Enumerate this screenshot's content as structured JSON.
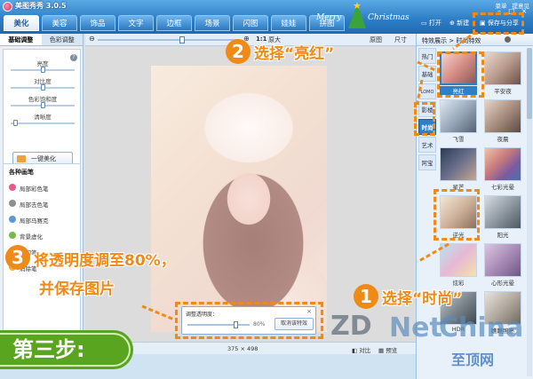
{
  "app": {
    "title": "美图秀秀 3.0.5"
  },
  "top_tabs": [
    "美化",
    "美容",
    "饰品",
    "文字",
    "边框",
    "场景",
    "闪图",
    "娃娃",
    "拼图"
  ],
  "top_links": {
    "menu": "菜单",
    "feedback": "提意见"
  },
  "banner": {
    "merry": "Merry",
    "christmas": "Christmas"
  },
  "toolbar": {
    "open": "打开",
    "new": "新建",
    "save_share": "保存与分享"
  },
  "left_panel": {
    "tabs": [
      "基础调整",
      "色彩调整"
    ],
    "sliders": [
      {
        "label": "亮度",
        "value": 0.5
      },
      {
        "label": "对比度",
        "value": 0.5
      },
      {
        "label": "色彩饱和度",
        "value": 0.5
      },
      {
        "label": "清晰度",
        "value": 0.05
      }
    ],
    "one_click_label": "一键美化",
    "brushes_title": "各种画笔",
    "brushes": [
      "局部彩色笔",
      "局部去色笔",
      "局部马赛克",
      "背景虚化",
      "魔幻笔",
      "消除笔"
    ]
  },
  "zoombar": {
    "ratio_label": "1:1",
    "original_label": "原大",
    "original_size_label": "原图",
    "size_label": "尺寸",
    "zoom_value": 0.6
  },
  "status": {
    "dimensions": "375 × 498",
    "compare": "对比",
    "preview": "预览"
  },
  "opacity_dialog": {
    "title": "调整透明度：",
    "value_text": "80%",
    "value": 0.8,
    "cancel": "取消该特效"
  },
  "right_panel": {
    "header": "特效展示 > 时尚特效",
    "categories": [
      "热门",
      "基础",
      "LOMO",
      "影楼",
      "时尚",
      "艺术",
      "阿宝"
    ],
    "selected_category": "时尚",
    "effects": [
      "亮红",
      "平安夜",
      "飞雪",
      "夜晨",
      "星芒",
      "七彩光晕",
      "逆光",
      "阳光",
      "炫彩",
      "心形光晕",
      "HDR",
      "瞧瞧照亮"
    ],
    "selected_effect": "亮红"
  },
  "annotations": {
    "step2_num": "2",
    "step2_text": "选择“亮红”",
    "step1_num": "1",
    "step1_text": "选择“时尚”",
    "step3_num": "3",
    "step3_line1": "将透明度调至80%，",
    "step3_line2": "并保存图片",
    "step_badge": "第三步:",
    "watermark_zd": "ZD",
    "watermark_net": "Net",
    "watermark_china": "China",
    "watermark_cn": "至顶网"
  },
  "colors": {
    "accent": "#f08a16",
    "titlebar": "#2f7fc6",
    "step_badge": "#5aa51f"
  }
}
